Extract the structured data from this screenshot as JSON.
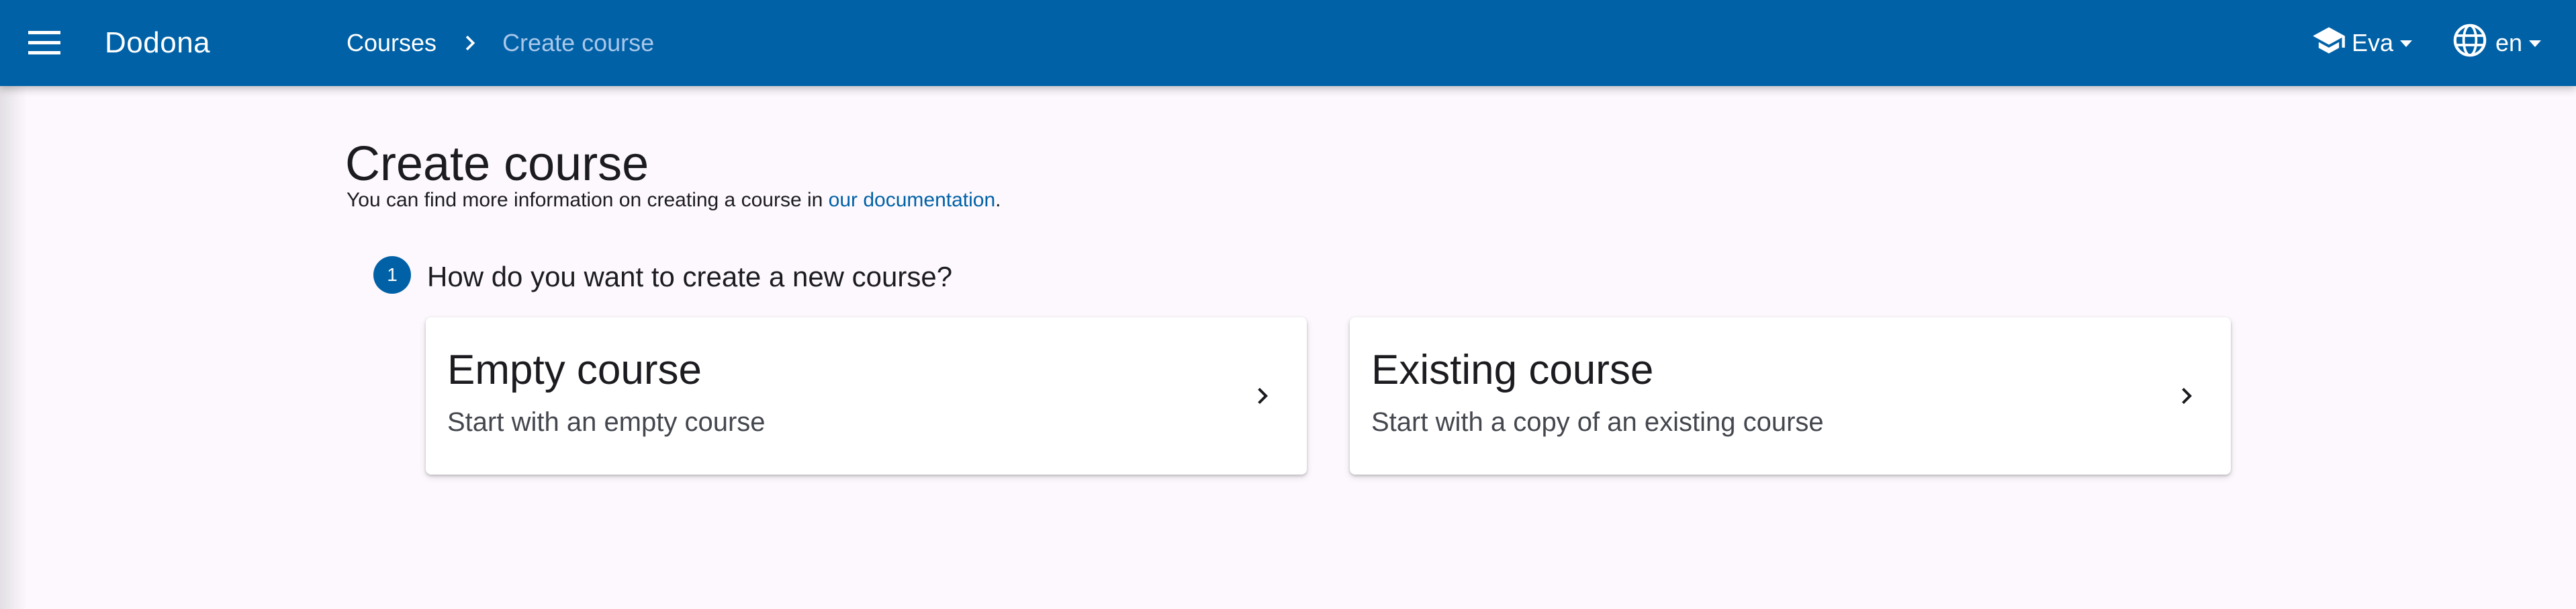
{
  "app": {
    "brand": "Dodona",
    "colors": {
      "primary": "#0061a6",
      "background": "#fcf8fd",
      "breadcrumb_current": "#a9c7ea"
    }
  },
  "header": {
    "menu_icon": "hamburger-menu-icon",
    "breadcrumb": {
      "items": [
        {
          "label": "Courses"
        }
      ],
      "current": "Create course",
      "separator_icon": "chevron-right-icon"
    },
    "user_menu": {
      "icon": "school-cap-icon",
      "label": "Eva"
    },
    "language_menu": {
      "icon": "globe-icon",
      "label": "en"
    }
  },
  "main": {
    "title": "Create course",
    "intro": {
      "text_before": "You can find more information on creating a course in ",
      "link_text": "our documentation",
      "text_after": "."
    },
    "step": {
      "number": "1",
      "question": "How do you want to create a new course?"
    },
    "options": [
      {
        "title": "Empty course",
        "subtitle": "Start with an empty course",
        "chevron_icon": "chevron-right-icon"
      },
      {
        "title": "Existing course",
        "subtitle": "Start with a copy of an existing course",
        "chevron_icon": "chevron-right-icon"
      }
    ]
  }
}
